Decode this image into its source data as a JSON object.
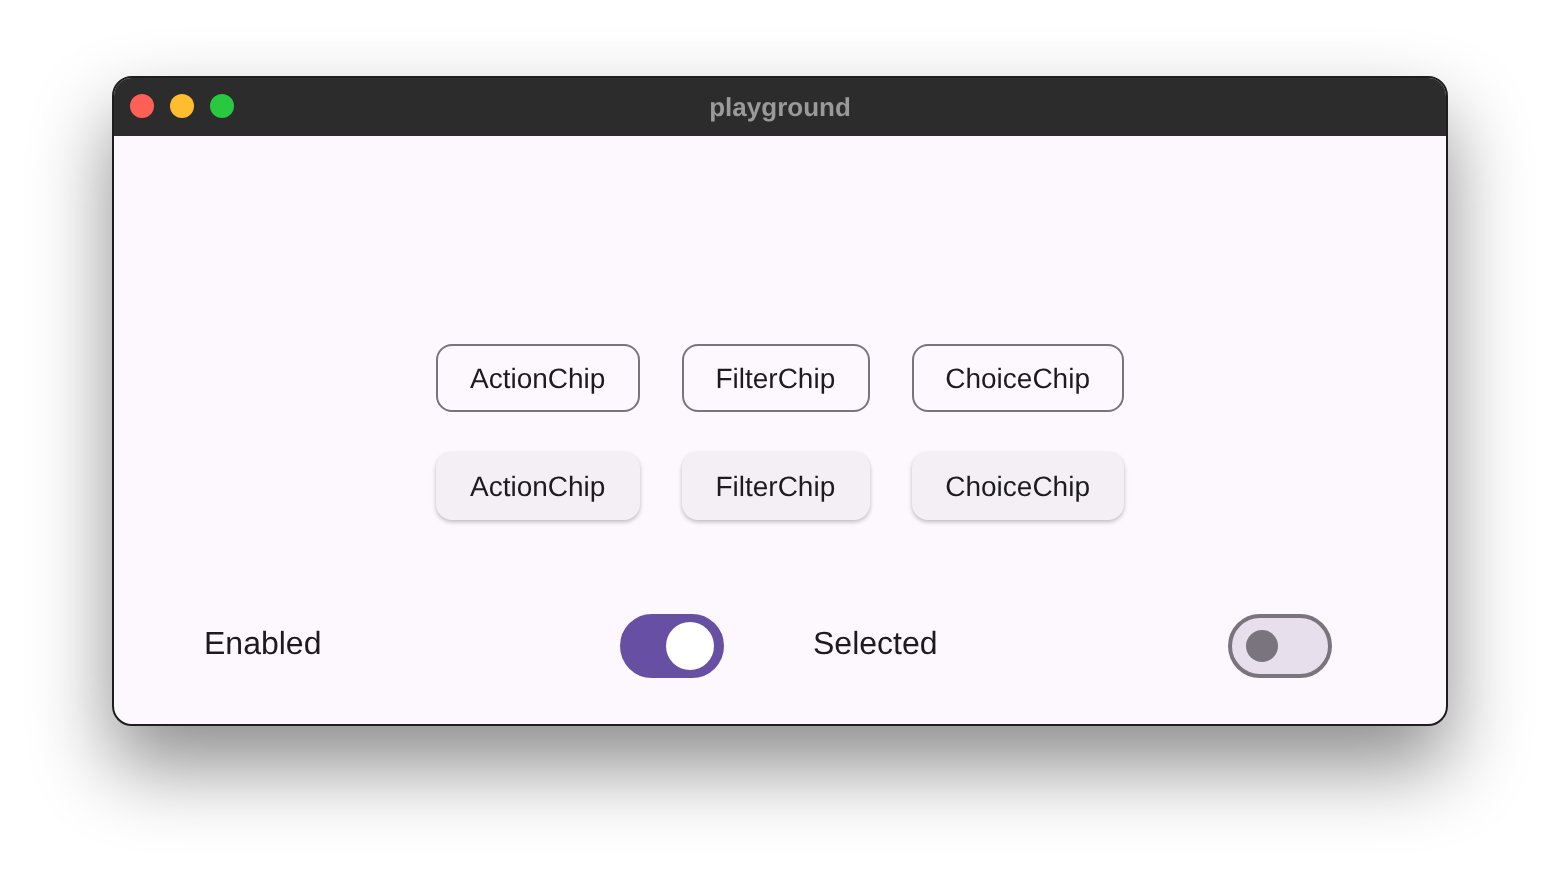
{
  "window": {
    "title": "playground"
  },
  "chip_rows": [
    {
      "kind": "outlined",
      "chips": [
        "ActionChip",
        "FilterChip",
        "ChoiceChip"
      ]
    },
    {
      "kind": "elevated",
      "chips": [
        "ActionChip",
        "FilterChip",
        "ChoiceChip"
      ]
    }
  ],
  "toggles": [
    {
      "label": "Enabled",
      "on": true
    },
    {
      "label": "Selected",
      "on": false
    }
  ]
}
